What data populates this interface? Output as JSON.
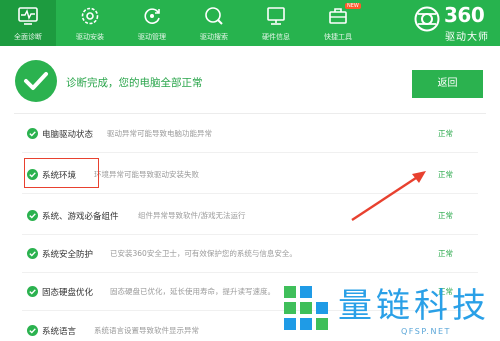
{
  "toolbar": {
    "tabs": [
      {
        "label": "全面诊断",
        "icon": "monitor-pulse-icon",
        "active": true
      },
      {
        "label": "驱动安装",
        "icon": "gear-icon",
        "active": false
      },
      {
        "label": "驱动管理",
        "icon": "refresh-icon",
        "active": false
      },
      {
        "label": "驱动搜索",
        "icon": "search-icon",
        "active": false
      },
      {
        "label": "硬件信息",
        "icon": "computer-icon",
        "active": false
      },
      {
        "label": "快捷工具",
        "icon": "toolbox-icon",
        "active": false,
        "badge": "NEW"
      }
    ],
    "brand": {
      "number": "360",
      "name": "驱动大师"
    }
  },
  "summary": {
    "message": "诊断完成，您的电脑全部正常",
    "back_label": "返回"
  },
  "checks": [
    {
      "name": "电脑驱动状态",
      "description": "驱动异常可能导致电脑功能异常",
      "status": "正常"
    },
    {
      "name": "系统环境",
      "description": "环境异常可能导致驱动安装失败",
      "status": "正常"
    },
    {
      "name": "系统、游戏必备组件",
      "description": "组件异常导致软件/游戏无法运行",
      "status": "正常"
    },
    {
      "name": "系统安全防护",
      "description": "已安装360安全卫士，可有效保护您的系统与信息安全。",
      "status": "正常"
    },
    {
      "name": "固态硬盘优化",
      "description": "固态硬盘已优化，延长使用寿命，提升读写速度。",
      "status": "正常"
    },
    {
      "name": "系统语言",
      "description": "系统语言设置导致软件显示异常",
      "status": ""
    }
  ],
  "watermark": {
    "name": "量链科技",
    "url": "QFSP.NET"
  },
  "colors": {
    "toolbar": "#27b34e",
    "accent": "#2bb24f",
    "highlight": "#e8412f",
    "watermark": "#1f9be6"
  }
}
